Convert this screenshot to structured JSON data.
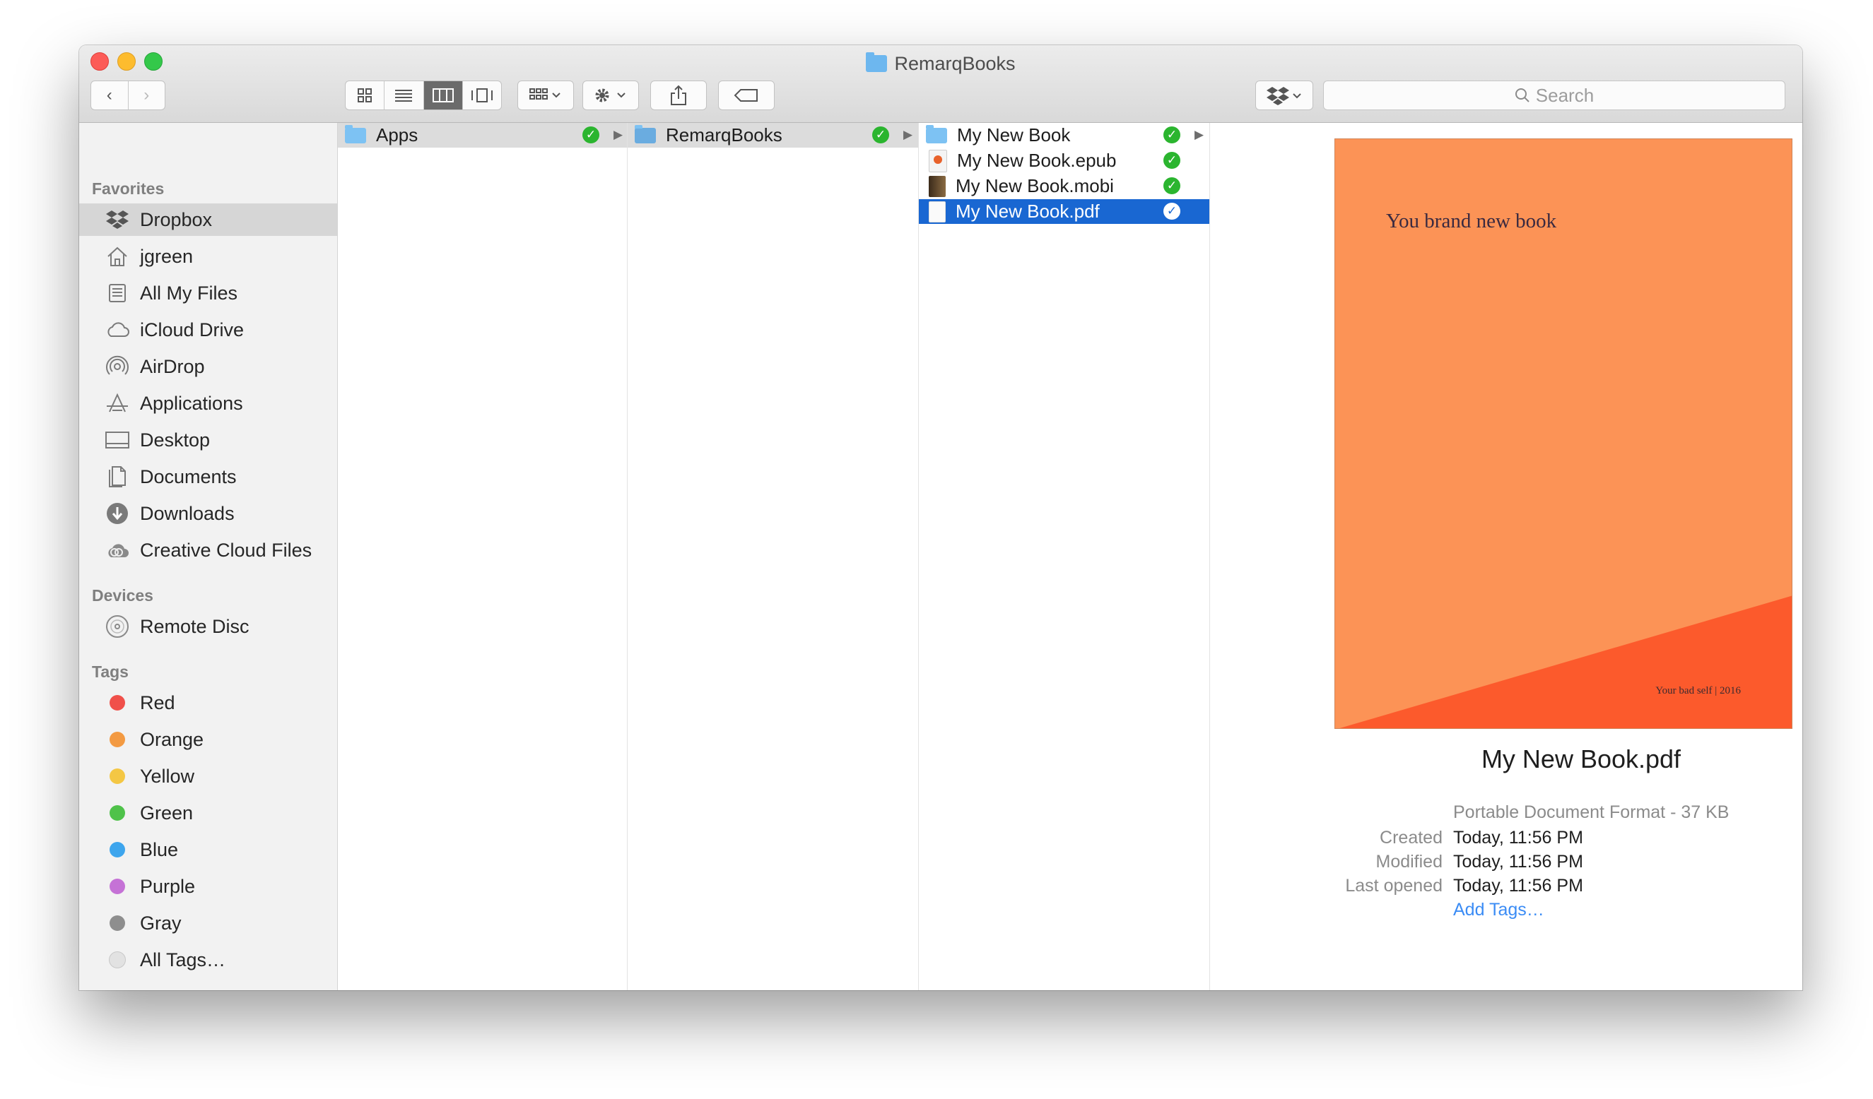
{
  "window": {
    "title": "RemarqBooks"
  },
  "toolbar": {
    "search_placeholder": "Search"
  },
  "sidebar": {
    "favorites_header": "Favorites",
    "favorites": [
      {
        "label": "Dropbox",
        "icon": "dropbox-icon"
      },
      {
        "label": "jgreen",
        "icon": "home-icon"
      },
      {
        "label": "All My Files",
        "icon": "all-files-icon"
      },
      {
        "label": "iCloud Drive",
        "icon": "cloud-icon"
      },
      {
        "label": "AirDrop",
        "icon": "airdrop-icon"
      },
      {
        "label": "Applications",
        "icon": "applications-icon"
      },
      {
        "label": "Desktop",
        "icon": "desktop-icon"
      },
      {
        "label": "Documents",
        "icon": "documents-icon"
      },
      {
        "label": "Downloads",
        "icon": "downloads-icon"
      },
      {
        "label": "Creative Cloud Files",
        "icon": "creative-cloud-icon"
      }
    ],
    "devices_header": "Devices",
    "devices": [
      {
        "label": "Remote Disc",
        "icon": "disc-icon"
      }
    ],
    "tags_header": "Tags",
    "tags": [
      {
        "label": "Red",
        "color": "#f0504a"
      },
      {
        "label": "Orange",
        "color": "#f39a42"
      },
      {
        "label": "Yellow",
        "color": "#f4c744"
      },
      {
        "label": "Green",
        "color": "#4fc24a"
      },
      {
        "label": "Blue",
        "color": "#3da5ed"
      },
      {
        "label": "Purple",
        "color": "#c572d6"
      },
      {
        "label": "Gray",
        "color": "#8e8e8e"
      },
      {
        "label": "All Tags…",
        "color": "#e2e2e2"
      }
    ]
  },
  "columns": {
    "col1": [
      {
        "label": "Apps",
        "type": "folder"
      }
    ],
    "col2": [
      {
        "label": "RemarqBooks",
        "type": "folder"
      }
    ],
    "col3": [
      {
        "label": "My New Book",
        "type": "folder"
      },
      {
        "label": "My New Book.epub",
        "type": "epub"
      },
      {
        "label": "My New Book.mobi",
        "type": "mobi"
      },
      {
        "label": "My New Book.pdf",
        "type": "pdf"
      }
    ]
  },
  "preview": {
    "cover_title": "You brand new book",
    "cover_footer": "Your bad self | 2016",
    "file_name": "My New Book.pdf",
    "kind": "Portable Document Format - 37 KB",
    "created_label": "Created",
    "created_value": "Today, 11:56 PM",
    "modified_label": "Modified",
    "modified_value": "Today, 11:56 PM",
    "last_opened_label": "Last opened",
    "last_opened_value": "Today, 11:56 PM",
    "add_tags": "Add Tags…"
  },
  "colors": {
    "accent": "#1967d2",
    "sync_ok": "#2bb52f",
    "link": "#3b8cf5"
  }
}
